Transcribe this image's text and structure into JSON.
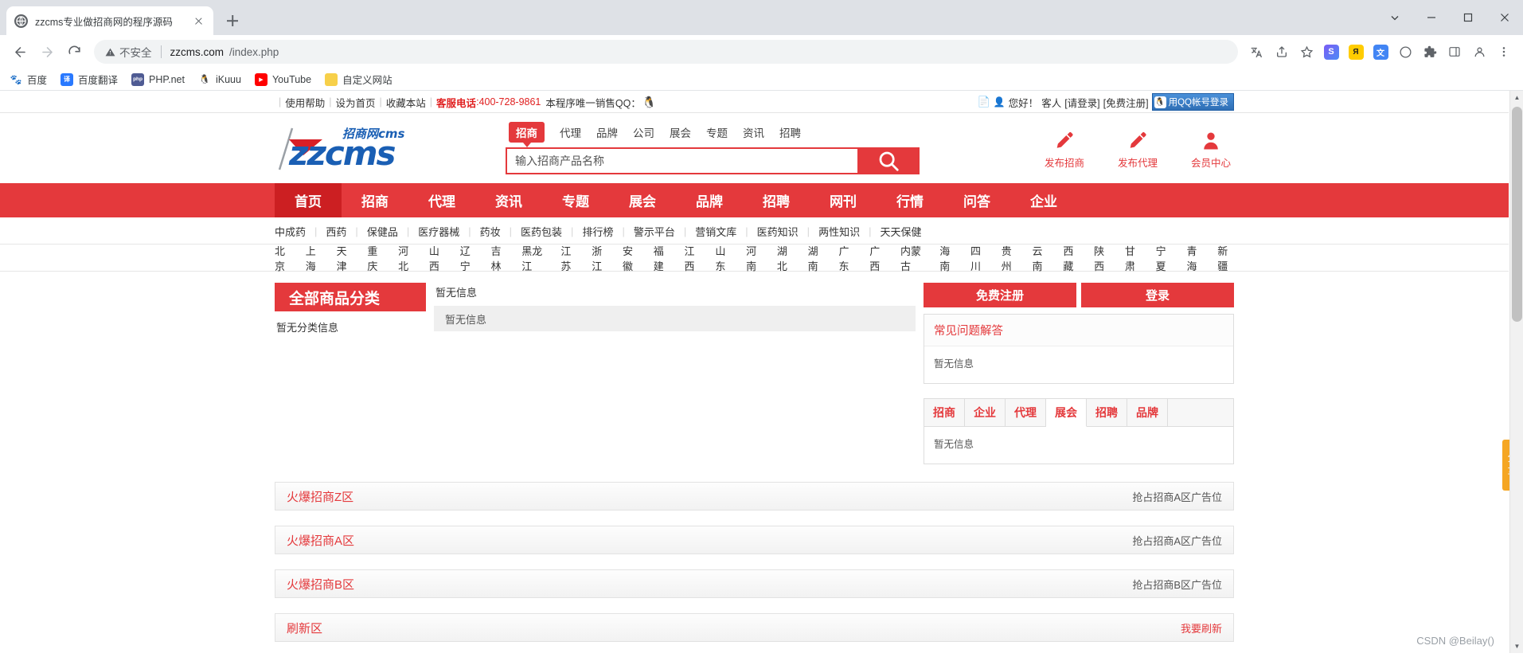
{
  "browser": {
    "tab_title": "zzcms专业做招商网的程序源码",
    "favicon": "globe-icon",
    "new_tab_label": "+",
    "url_security_label": "不安全",
    "url_domain": "zzcms.com",
    "url_path": "/index.php",
    "toolbar_icons": [
      "translate-icon",
      "share-icon",
      "bookmark-star-icon",
      "extension-s-icon",
      "yandex-icon",
      "google-translate-icon",
      "circle-icon",
      "puzzle-icon",
      "sidepanel-icon",
      "profile-icon",
      "menu-icon"
    ],
    "window_controls": [
      "minimize",
      "maximize",
      "close",
      "chevron-down"
    ],
    "bookmarks": [
      {
        "label": "百度",
        "icon": "baidu-icon",
        "color": "#3b5fd0"
      },
      {
        "label": "百度翻译",
        "icon": "translate-icon",
        "color": "#2979ff"
      },
      {
        "label": "PHP.net",
        "icon": "php-icon",
        "color": "#4f5b93"
      },
      {
        "label": "iKuuu",
        "icon": "ikuuu-icon",
        "color": "#2b2b2b"
      },
      {
        "label": "YouTube",
        "icon": "youtube-icon",
        "color": "#ff0000"
      },
      {
        "label": "自定义网站",
        "icon": "folder-icon",
        "color": "#f7d04a"
      }
    ]
  },
  "topbar": {
    "links": [
      "使用帮助",
      "设为首页",
      "收藏本站"
    ],
    "service_label": "客服电话",
    "service_phone": ":400-728-9861",
    "sale_qq_text": "本程序唯一销售QQ：",
    "greeting": "您好！",
    "guest": "客人",
    "login": "[请登录]",
    "register": "[免费注册]",
    "qq_login": "用QQ帐号登录"
  },
  "header": {
    "logo_main": "zzcms",
    "logo_sub": "招商网cms",
    "search_tabs": [
      {
        "label": "招商",
        "active": true
      },
      {
        "label": "代理",
        "active": false
      },
      {
        "label": "品牌",
        "active": false
      },
      {
        "label": "公司",
        "active": false
      },
      {
        "label": "展会",
        "active": false
      },
      {
        "label": "专题",
        "active": false
      },
      {
        "label": "资讯",
        "active": false
      },
      {
        "label": "招聘",
        "active": false
      }
    ],
    "search_placeholder": "输入招商产品名称",
    "search_value": "",
    "search_icon": "magnifier-icon",
    "quick_links": [
      {
        "label": "发布招商",
        "icon": "pencil-icon"
      },
      {
        "label": "发布代理",
        "icon": "pencil-icon"
      },
      {
        "label": "会员中心",
        "icon": "user-icon"
      }
    ]
  },
  "main_nav": [
    {
      "label": "首页",
      "active": true
    },
    {
      "label": "招商",
      "active": false
    },
    {
      "label": "代理",
      "active": false
    },
    {
      "label": "资讯",
      "active": false
    },
    {
      "label": "专题",
      "active": false
    },
    {
      "label": "展会",
      "active": false
    },
    {
      "label": "品牌",
      "active": false
    },
    {
      "label": "招聘",
      "active": false
    },
    {
      "label": "网刊",
      "active": false
    },
    {
      "label": "行情",
      "active": false
    },
    {
      "label": "问答",
      "active": false
    },
    {
      "label": "企业",
      "active": false
    }
  ],
  "sub_nav": [
    "中成药",
    "西药",
    "保健品",
    "医疗器械",
    "药妆",
    "医药包装",
    "排行榜",
    "警示平台",
    "营销文库",
    "医药知识",
    "两性知识",
    "天天保健"
  ],
  "city_nav": [
    "北京",
    "上海",
    "天津",
    "重庆",
    "河北",
    "山西",
    "辽宁",
    "吉林",
    "黑龙江",
    "江苏",
    "浙江",
    "安徽",
    "福建",
    "江西",
    "山东",
    "河南",
    "湖北",
    "湖南",
    "广东",
    "广西",
    "内蒙古",
    "海南",
    "四川",
    "贵州",
    "云南",
    "西藏",
    "陕西",
    "甘肃",
    "宁夏",
    "青海",
    "新疆"
  ],
  "content": {
    "category_title": "全部商品分类",
    "category_empty": "暂无分类信息",
    "mid_note": "暂无信息",
    "mid_box": "暂无信息",
    "register_button": "免费注册",
    "login_button": "登录",
    "faq_title": "常见问题解答",
    "faq_empty": "暂无信息",
    "right_tabs": [
      {
        "label": "招商",
        "active": false
      },
      {
        "label": "企业",
        "active": false
      },
      {
        "label": "代理",
        "active": false
      },
      {
        "label": "展会",
        "active": true
      },
      {
        "label": "招聘",
        "active": false
      },
      {
        "label": "品牌",
        "active": false
      }
    ],
    "right_tab_empty": "暂无信息"
  },
  "zones": [
    {
      "title": "火爆招商Z区",
      "ad": "抢占招商A区广告位",
      "red": false
    },
    {
      "title": "火爆招商A区",
      "ad": "抢占招商A区广告位",
      "red": false
    },
    {
      "title": "火爆招商B区",
      "ad": "抢占招商B区广告位",
      "red": false
    },
    {
      "title": "刷新区",
      "ad": "我要刷新",
      "red": true
    }
  ],
  "share_tab": "分享",
  "watermark": "CSDN @Beilay()"
}
